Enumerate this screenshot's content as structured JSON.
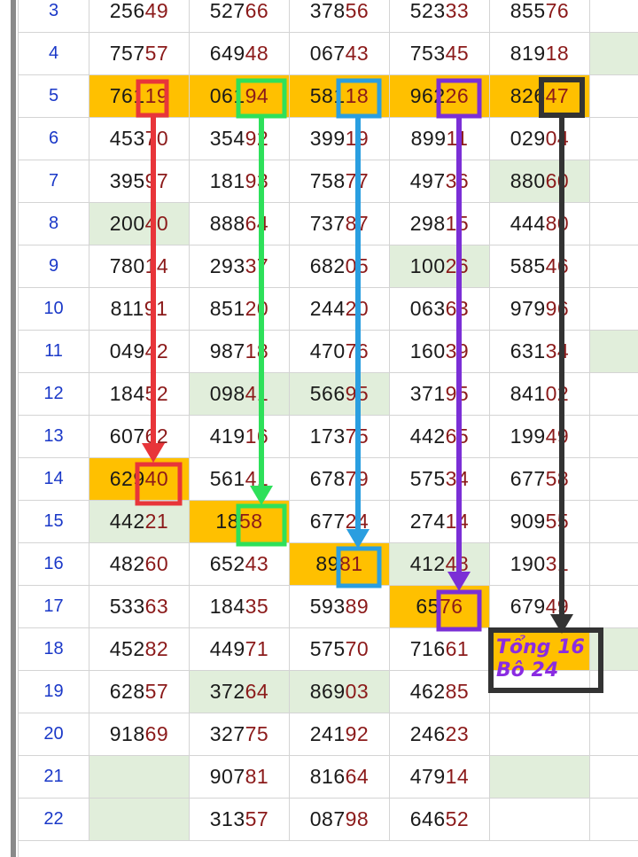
{
  "rows": [
    {
      "label": "3",
      "cells": [
        {
          "p": "256",
          "s": "49"
        },
        {
          "p": "527",
          "s": "66"
        },
        {
          "p": "378",
          "s": "56"
        },
        {
          "p": "523",
          "s": "33"
        },
        {
          "p": "855",
          "s": "76"
        }
      ]
    },
    {
      "label": "4",
      "cells": [
        {
          "p": "757",
          "s": "57"
        },
        {
          "p": "649",
          "s": "48"
        },
        {
          "p": "067",
          "s": "43"
        },
        {
          "p": "753",
          "s": "45"
        },
        {
          "p": "819",
          "s": "18"
        }
      ]
    },
    {
      "label": "5",
      "cells": [
        {
          "p": "761",
          "s": "19"
        },
        {
          "p": "061",
          "s": "94"
        },
        {
          "p": "581",
          "s": "18"
        },
        {
          "p": "962",
          "s": "26"
        },
        {
          "p": "826",
          "s": "47"
        }
      ]
    },
    {
      "label": "6",
      "cells": [
        {
          "p": "453",
          "s": "70"
        },
        {
          "p": "354",
          "s": "92"
        },
        {
          "p": "399",
          "s": "19"
        },
        {
          "p": "899",
          "s": "11"
        },
        {
          "p": "029",
          "s": "04"
        }
      ]
    },
    {
      "label": "7",
      "cells": [
        {
          "p": "395",
          "s": "97"
        },
        {
          "p": "181",
          "s": "93"
        },
        {
          "p": "758",
          "s": "77"
        },
        {
          "p": "497",
          "s": "36"
        },
        {
          "p": "880",
          "s": "60"
        }
      ]
    },
    {
      "label": "8",
      "cells": [
        {
          "p": "200",
          "s": "40"
        },
        {
          "p": "888",
          "s": "64"
        },
        {
          "p": "737",
          "s": "87"
        },
        {
          "p": "298",
          "s": "15"
        },
        {
          "p": "444",
          "s": "80"
        }
      ]
    },
    {
      "label": "9",
      "cells": [
        {
          "p": "780",
          "s": "14"
        },
        {
          "p": "293",
          "s": "37"
        },
        {
          "p": "682",
          "s": "05"
        },
        {
          "p": "100",
          "s": "26"
        },
        {
          "p": "585",
          "s": "46"
        }
      ]
    },
    {
      "label": "10",
      "cells": [
        {
          "p": "811",
          "s": "91"
        },
        {
          "p": "851",
          "s": "20"
        },
        {
          "p": "244",
          "s": "20"
        },
        {
          "p": "063",
          "s": "63"
        },
        {
          "p": "979",
          "s": "96"
        }
      ]
    },
    {
      "label": "11",
      "cells": [
        {
          "p": "049",
          "s": "42"
        },
        {
          "p": "987",
          "s": "18"
        },
        {
          "p": "470",
          "s": "76"
        },
        {
          "p": "160",
          "s": "39"
        },
        {
          "p": "631",
          "s": "34"
        }
      ]
    },
    {
      "label": "12",
      "cells": [
        {
          "p": "184",
          "s": "52"
        },
        {
          "p": "098",
          "s": "41"
        },
        {
          "p": "566",
          "s": "95"
        },
        {
          "p": "371",
          "s": "95"
        },
        {
          "p": "841",
          "s": "02"
        }
      ]
    },
    {
      "label": "13",
      "cells": [
        {
          "p": "607",
          "s": "62"
        },
        {
          "p": "419",
          "s": "16"
        },
        {
          "p": "173",
          "s": "75"
        },
        {
          "p": "442",
          "s": "65"
        },
        {
          "p": "199",
          "s": "49"
        }
      ]
    },
    {
      "label": "14",
      "cells": [
        {
          "p": "629",
          "s": "40"
        },
        {
          "p": "561",
          "s": "41"
        },
        {
          "p": "678",
          "s": "79"
        },
        {
          "p": "575",
          "s": "34"
        },
        {
          "p": "677",
          "s": "58"
        }
      ]
    },
    {
      "label": "15",
      "cells": [
        {
          "p": "442",
          "s": "21"
        },
        {
          "p": "18",
          "s": "58"
        },
        {
          "p": "677",
          "s": "24"
        },
        {
          "p": "274",
          "s": "14"
        },
        {
          "p": "909",
          "s": "55"
        }
      ]
    },
    {
      "label": "16",
      "cells": [
        {
          "p": "482",
          "s": "60"
        },
        {
          "p": "652",
          "s": "43"
        },
        {
          "p": "89",
          "s": "81"
        },
        {
          "p": "412",
          "s": "48"
        },
        {
          "p": "190",
          "s": "31"
        }
      ]
    },
    {
      "label": "17",
      "cells": [
        {
          "p": "533",
          "s": "63"
        },
        {
          "p": "184",
          "s": "35"
        },
        {
          "p": "593",
          "s": "89"
        },
        {
          "p": "65",
          "s": "76"
        },
        {
          "p": "679",
          "s": "49"
        }
      ]
    },
    {
      "label": "18",
      "cells": [
        {
          "p": "452",
          "s": "82"
        },
        {
          "p": "449",
          "s": "71"
        },
        {
          "p": "575",
          "s": "70"
        },
        {
          "p": "716",
          "s": "61"
        },
        {
          "p": "",
          "s": ""
        }
      ]
    },
    {
      "label": "19",
      "cells": [
        {
          "p": "628",
          "s": "57"
        },
        {
          "p": "372",
          "s": "64"
        },
        {
          "p": "869",
          "s": "03"
        },
        {
          "p": "462",
          "s": "85"
        },
        {
          "p": "",
          "s": ""
        }
      ]
    },
    {
      "label": "20",
      "cells": [
        {
          "p": "918",
          "s": "69"
        },
        {
          "p": "327",
          "s": "75"
        },
        {
          "p": "241",
          "s": "92"
        },
        {
          "p": "246",
          "s": "23"
        },
        {
          "p": "",
          "s": ""
        }
      ]
    },
    {
      "label": "21",
      "cells": [
        {
          "p": "",
          "s": ""
        },
        {
          "p": "907",
          "s": "81"
        },
        {
          "p": "816",
          "s": "64"
        },
        {
          "p": "479",
          "s": "14"
        },
        {
          "p": "",
          "s": ""
        }
      ]
    },
    {
      "label": "22",
      "cells": [
        {
          "p": "",
          "s": ""
        },
        {
          "p": "313",
          "s": "57"
        },
        {
          "p": "087",
          "s": "98"
        },
        {
          "p": "646",
          "s": "52"
        },
        {
          "p": "",
          "s": ""
        }
      ]
    }
  ],
  "annotation": {
    "line1": "Tổng 16",
    "line2": "Bô 24"
  },
  "colors": {
    "highlight": "#ffc000",
    "green_fill": "#e1eedb",
    "red": "#e8353a",
    "green": "#2ee05a",
    "blue": "#2a9ee0",
    "purple": "#7b2fd6",
    "black": "#333333"
  }
}
